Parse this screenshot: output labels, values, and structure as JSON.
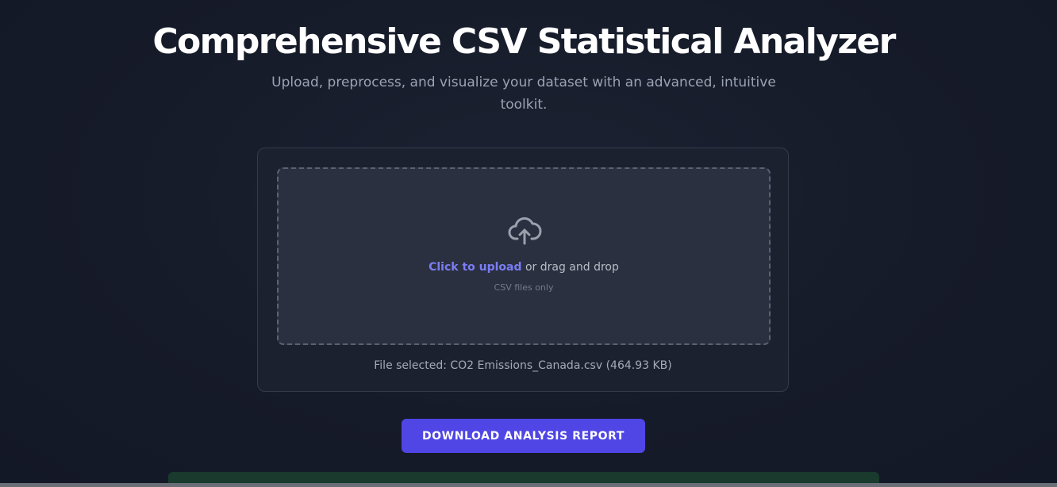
{
  "header": {
    "title": "Comprehensive CSV Statistical Analyzer",
    "subtitle": "Upload, preprocess, and visualize your dataset with an advanced, intuitive toolkit."
  },
  "upload": {
    "icon": "cloud-upload-icon",
    "click_label": "Click to upload",
    "drag_label": " or drag and drop",
    "hint": "CSV files only",
    "file_selected": "File selected: CO2 Emissions_Canada.csv (464.93 KB)"
  },
  "actions": {
    "download_label": "DOWNLOAD ANALYSIS REPORT"
  },
  "colors": {
    "accent": "#4f46e5",
    "link": "#7b7df5",
    "background": "#161b29",
    "result_panel": "#1a3a2d"
  }
}
